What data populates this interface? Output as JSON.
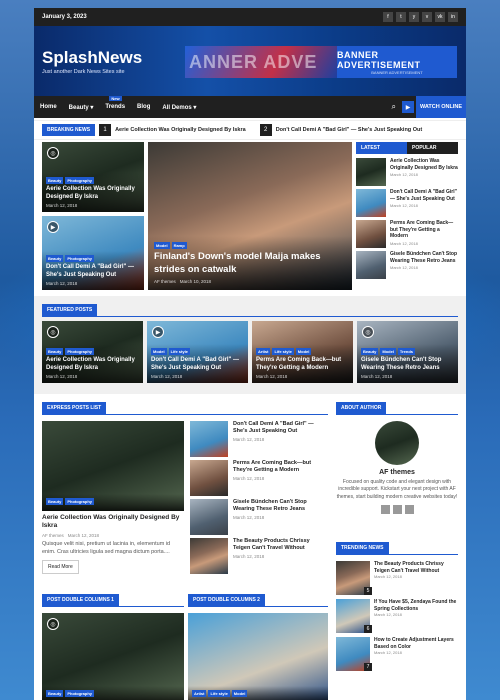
{
  "topbar": {
    "date": "January 3, 2023",
    "social": [
      "f",
      "t",
      "y",
      "v",
      "vk",
      "in"
    ]
  },
  "header": {
    "logo": "SplashNews",
    "tagline": "Just another Dark News Sites site",
    "banner_left": "ANNER ADVE",
    "banner_title": "BANNER ADVERTISEMENT",
    "banner_sub": "BANNER ADVERTISEMENT"
  },
  "nav": {
    "items": [
      "Home",
      "Beauty ▾",
      "Trends",
      "Blog",
      "All Demos ▾"
    ],
    "new_badge": "New",
    "watch": "WATCH ONLINE"
  },
  "ticker": {
    "label": "BREAKING NEWS",
    "n1": "1",
    "t1": "Aerie Collection Was Originally Designed By Iskra",
    "n2": "2",
    "t2": "Don't Call Demi A \"Bad Girl\" — She's Just Speaking Out"
  },
  "hero": {
    "left1": {
      "tags": [
        "Beauty",
        "Photography"
      ],
      "title": "Aerie Collection Was Originally Designed By Iskra",
      "date": "March 12, 2018"
    },
    "left2": {
      "tags": [
        "Beauty",
        "Photography"
      ],
      "title": "Don't Call Demi A \"Bad Girl\" — She's Just Speaking Out",
      "date": "March 12, 2018"
    },
    "main": {
      "tags": [
        "Model",
        "Ramp"
      ],
      "title": "Finland's Down's model Maija makes strides on catwalk",
      "author": "AF themes",
      "date": "March 10, 2018"
    }
  },
  "tabs": {
    "latest": "LATEST",
    "popular": "POPULAR",
    "items": [
      {
        "title": "Aerie Collection Was Originally Designed By Iskra",
        "date": "March 12, 2018"
      },
      {
        "title": "Don't Call Demi A \"Bad Girl\" — She's Just Speaking Out",
        "date": "March 12, 2018"
      },
      {
        "title": "Perms Are Coming Back—but They're Getting a Modern",
        "date": "March 12, 2018"
      },
      {
        "title": "Gisele Bündchen Can't Stop Wearing These Retro Jeans",
        "date": "March 12, 2018"
      }
    ]
  },
  "featured": {
    "label": "FEATURED POSTS",
    "items": [
      {
        "tags": [
          "Beauty",
          "Photography"
        ],
        "title": "Aerie Collection Was Originally Designed By Iskra",
        "date": "March 12, 2018"
      },
      {
        "tags": [
          "Model",
          "Life style"
        ],
        "title": "Don't Call Demi A \"Bad Girl\" — She's Just Speaking Out",
        "date": "March 12, 2018"
      },
      {
        "tags": [
          "Artist",
          "Life style",
          "Model"
        ],
        "title": "Perms Are Coming Back—but They're Getting a Modern",
        "date": "March 12, 2018"
      },
      {
        "tags": [
          "Beauty",
          "Model",
          "Trends"
        ],
        "title": "Gisele Bündchen Can't Stop Wearing These Retro Jeans",
        "date": "March 12, 2018"
      }
    ]
  },
  "express": {
    "label": "EXPRESS POSTS LIST",
    "main": {
      "tags": [
        "Beauty",
        "Photography"
      ],
      "title": "Aerie Collection Was Originally Designed By Iskra",
      "author": "AF themes",
      "date": "March 12, 2018",
      "excerpt": "Quisque velit nisi, pretium ut lacinia in, elementum id enim. Cras ultricies ligula sed magna dictum porta....",
      "read_more": "Read More"
    },
    "items": [
      {
        "title": "Don't Call Demi A \"Bad Girl\" — She's Just Speaking Out",
        "date": "March 12, 2018"
      },
      {
        "title": "Perms Are Coming Back—but They're Getting a Modern",
        "date": "March 12, 2018"
      },
      {
        "title": "Gisele Bündchen Can't Stop Wearing These Retro Jeans",
        "date": "March 12, 2018"
      },
      {
        "title": "The Beauty Products Chrissy Teigen Can't Travel Without",
        "date": "March 12, 2018"
      }
    ]
  },
  "about": {
    "label": "ABOUT AUTHOR",
    "name": "AF themes",
    "bio": "Focused on quality code and elegant design with incredible support. Kickstart your next project with AF themes, start building modern creative websites today!"
  },
  "trending": {
    "label": "TRENDING NEWS",
    "items": [
      {
        "n": "5",
        "title": "The Beauty Products Chrissy Teigen Can't Travel Without",
        "date": "March 12, 2018"
      },
      {
        "n": "6",
        "title": "If You Have $5, Zendaya Found the Spring Collections",
        "date": "March 12, 2018"
      },
      {
        "n": "7",
        "title": "How to Create Adjustment Layers Based on Color",
        "date": "March 12, 2018"
      }
    ]
  },
  "double1": {
    "label": "POST DOUBLE COLUMNS 1",
    "tags": [
      "Beauty",
      "Photography"
    ]
  },
  "double2": {
    "label": "POST DOUBLE COLUMNS 2",
    "tags": [
      "Artist",
      "Life style",
      "Model"
    ]
  }
}
